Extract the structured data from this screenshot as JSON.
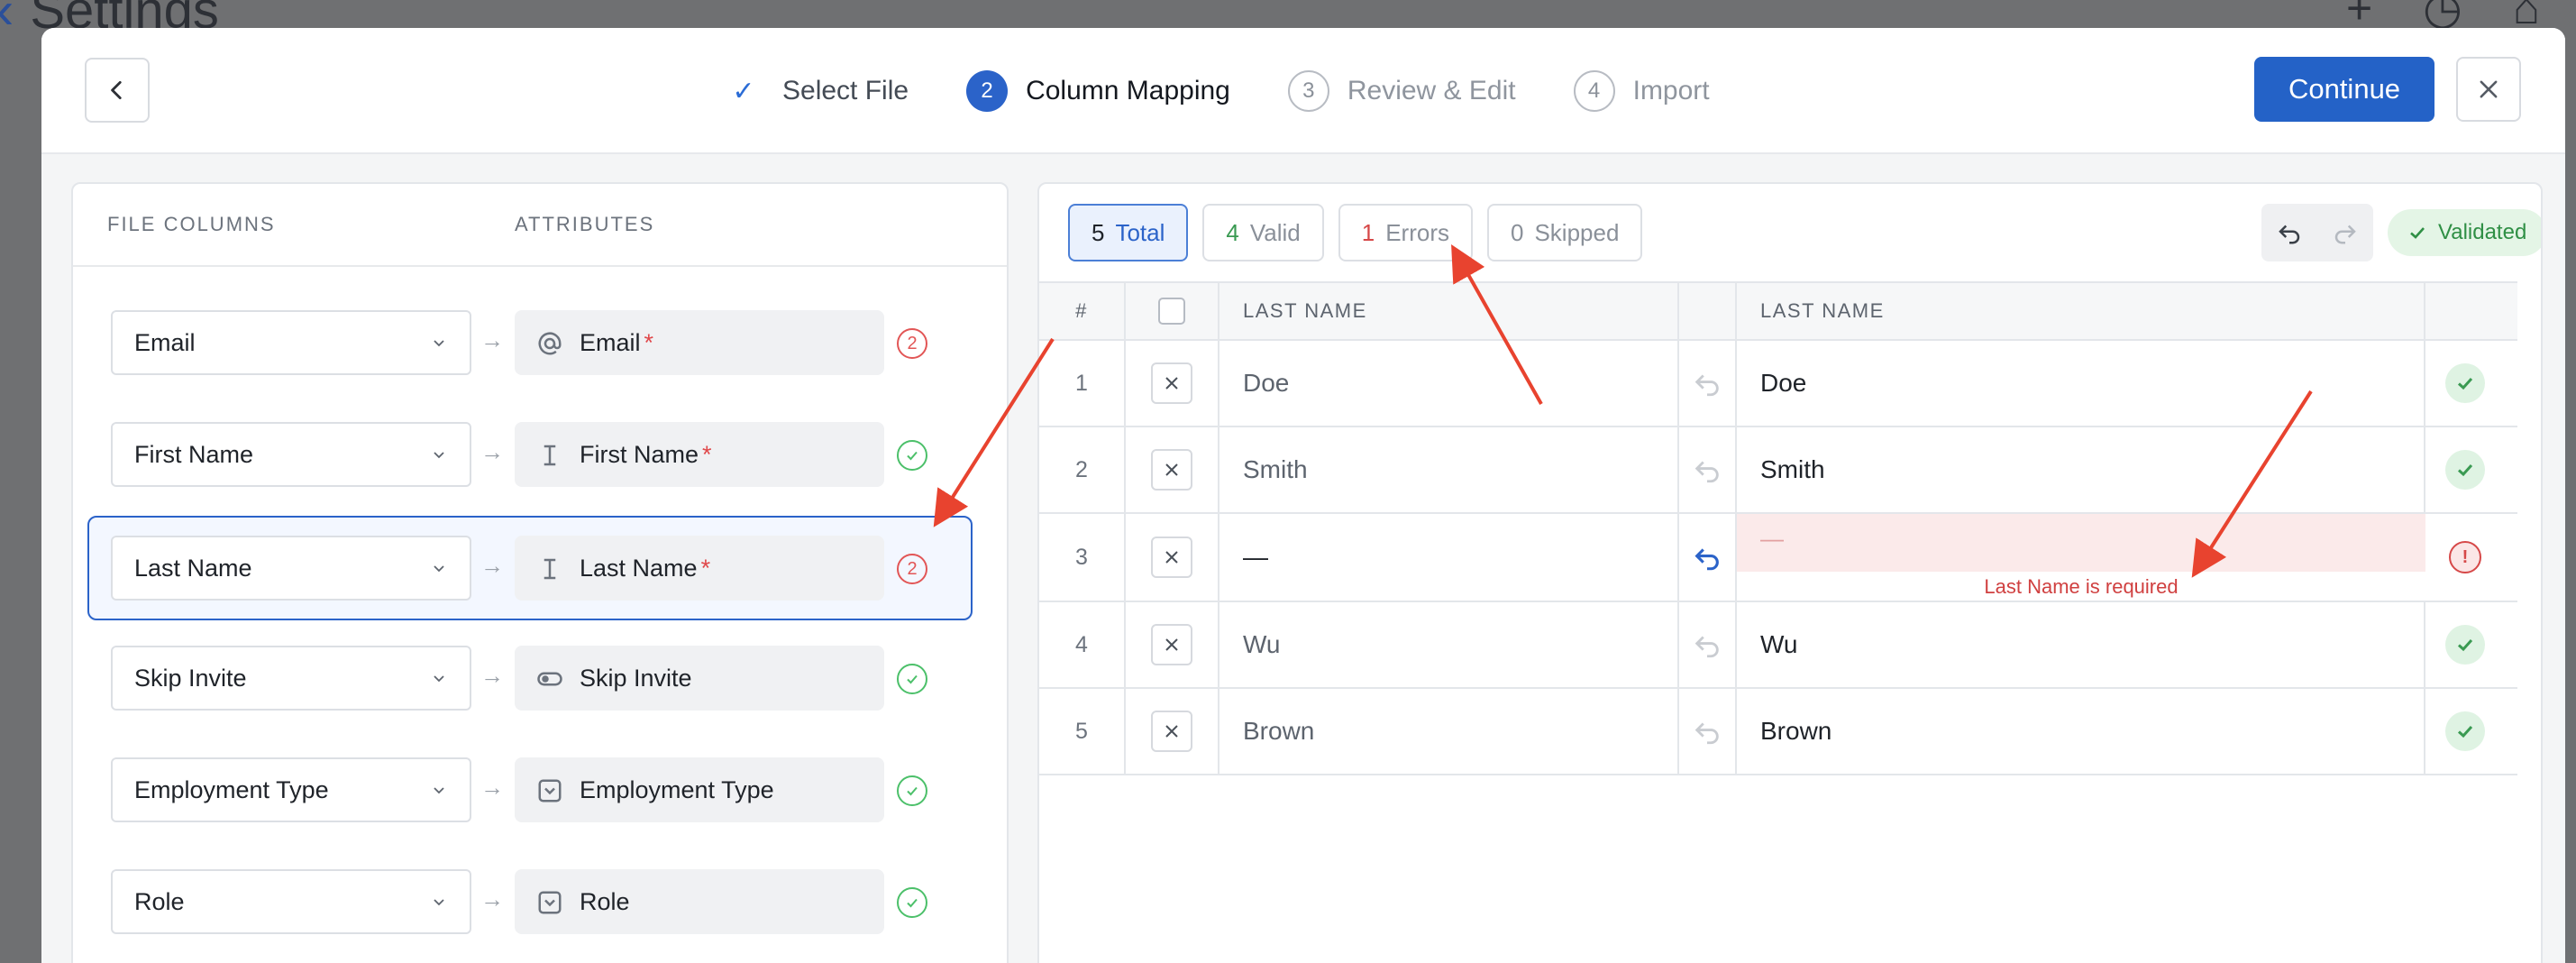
{
  "background": {
    "title": "Settings"
  },
  "header": {
    "steps": [
      {
        "number": "✓",
        "label": "Select File",
        "state": "done"
      },
      {
        "number": "2",
        "label": "Column Mapping",
        "state": "active"
      },
      {
        "number": "3",
        "label": "Review & Edit",
        "state": "todo"
      },
      {
        "number": "4",
        "label": "Import",
        "state": "todo"
      }
    ],
    "continue_label": "Continue"
  },
  "left": {
    "col_file": "FILE COLUMNS",
    "col_attr": "ATTRIBUTES",
    "rows": [
      {
        "source": "Email",
        "attribute": "Email",
        "required": "*",
        "icon": "at-icon",
        "status": "error",
        "count": "2"
      },
      {
        "source": "First Name",
        "attribute": "First Name",
        "required": "*",
        "icon": "text-cursor-icon",
        "status": "ok",
        "count": ""
      },
      {
        "source": "Last Name",
        "attribute": "Last Name",
        "required": "*",
        "icon": "text-cursor-icon",
        "status": "error",
        "count": "2"
      },
      {
        "source": "Skip Invite",
        "attribute": "Skip Invite",
        "required": "",
        "icon": "toggle-icon",
        "status": "ok",
        "count": ""
      },
      {
        "source": "Employment Type",
        "attribute": "Employment Type",
        "required": "",
        "icon": "dropdown-icon",
        "status": "ok",
        "count": ""
      },
      {
        "source": "Role",
        "attribute": "Role",
        "required": "",
        "icon": "dropdown-icon",
        "status": "ok",
        "count": ""
      }
    ]
  },
  "right": {
    "filters": [
      {
        "count": "5",
        "label": "Total"
      },
      {
        "count": "4",
        "label": "Valid"
      },
      {
        "count": "1",
        "label": "Errors"
      },
      {
        "count": "0",
        "label": "Skipped"
      }
    ],
    "validated_label": "Validated",
    "columns": {
      "num": "#",
      "source": "LAST NAME",
      "target": "LAST NAME"
    },
    "rows": [
      {
        "num": "1",
        "source": "Doe",
        "target": "Doe",
        "status": "ok"
      },
      {
        "num": "2",
        "source": "Smith",
        "target": "Smith",
        "status": "ok"
      },
      {
        "num": "3",
        "source": "—",
        "target": "—",
        "status": "error",
        "error": "Last Name is required"
      },
      {
        "num": "4",
        "source": "Wu",
        "target": "Wu",
        "status": "ok"
      },
      {
        "num": "5",
        "source": "Brown",
        "target": "Brown",
        "status": "ok"
      }
    ]
  },
  "colors": {
    "accent": "#2462c7",
    "error": "#d64848",
    "success": "#3a9a52",
    "annotation": "#e8432f"
  }
}
